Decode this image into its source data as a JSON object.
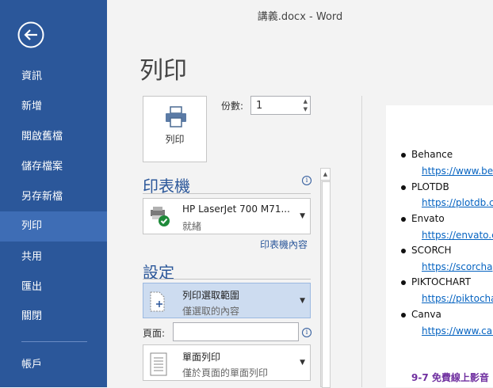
{
  "window": {
    "title": "講義.docx - Word"
  },
  "sidebar": {
    "items": [
      {
        "label": "資訊"
      },
      {
        "label": "新增"
      },
      {
        "label": "開啟舊檔"
      },
      {
        "label": "儲存檔案"
      },
      {
        "label": "另存新檔"
      },
      {
        "label": "列印",
        "active": true
      },
      {
        "label": "共用"
      },
      {
        "label": "匯出"
      },
      {
        "label": "關閉"
      }
    ],
    "account": "帳戶"
  },
  "print": {
    "title": "列印",
    "button_label": "列印",
    "copies_label": "份數:",
    "copies_value": "1"
  },
  "printer": {
    "section_title": "印表機",
    "name": "HP LaserJet 700 M71...",
    "status": "就緒",
    "properties_link": "印表機內容"
  },
  "settings": {
    "section_title": "設定",
    "range_main": "列印選取範圍",
    "range_sub": "僅選取的內容",
    "pages_label": "頁面:",
    "pages_value": "",
    "sides_main": "單面列印",
    "sides_sub": "僅於頁面的單面列印"
  },
  "preview": {
    "items": [
      {
        "name": "Behance",
        "url": "https://www.beha"
      },
      {
        "name": "PLOTDB",
        "url": "https://plotdb.com"
      },
      {
        "name": "Envato",
        "url": "https://envato.co"
      },
      {
        "name": "SCORCH",
        "url": "https://scorchage"
      },
      {
        "name": "PIKTOCHART",
        "url": "https://piktochart"
      },
      {
        "name": "Canva",
        "url": "https://www.canv"
      }
    ],
    "section_heading": "9-7 免費線上影音"
  },
  "colors": {
    "accent": "#2b579a",
    "sidebar_active": "#3e6db5",
    "link": "#0563c1",
    "heading_purple": "#7030a0"
  }
}
